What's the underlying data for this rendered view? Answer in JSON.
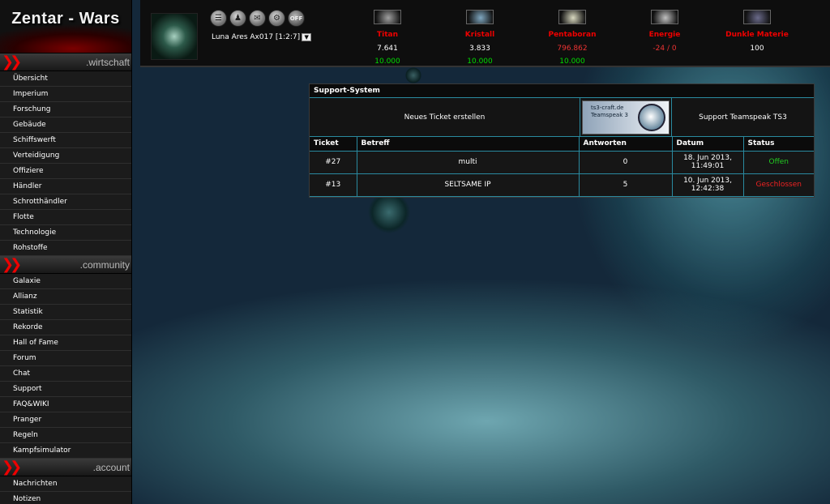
{
  "sidebar": {
    "logo": "Zentar - Wars",
    "sections": [
      {
        "title": ".wirtschaft",
        "items": [
          "Übersicht",
          "Imperium",
          "Forschung",
          "Gebäude",
          "Schiffswerft",
          "Verteidigung",
          "Offiziere",
          "Händler",
          "Schrotthändler",
          "Flotte",
          "Technologie",
          "Rohstoffe"
        ]
      },
      {
        "title": ".community",
        "items": [
          "Galaxie",
          "Allianz",
          "Statistik",
          "Rekorde",
          "Hall of Fame",
          "Forum",
          "Chat",
          "Support",
          "FAQ&WIKI",
          "Pranger",
          "Regeln",
          "Kampfsimulator"
        ]
      },
      {
        "title": ".account",
        "items": [
          "Nachrichten",
          "Notizen"
        ]
      }
    ]
  },
  "topbar": {
    "planet": "Luna Ares Ax017 [1:2:7]",
    "icons": [
      "notes-icon",
      "buddy-icon",
      "mail-icon",
      "settings-icon"
    ],
    "off_label": "OFF",
    "resources": [
      {
        "name": "Titan",
        "amount": "7.641",
        "cap": "10.000",
        "img_color": "#a0a0a0",
        "amount_red": false
      },
      {
        "name": "Kristall",
        "amount": "3.833",
        "cap": "10.000",
        "img_color": "#7fa7c0",
        "amount_red": false
      },
      {
        "name": "Pentaboran",
        "amount": "796.862",
        "cap": "10.000",
        "img_color": "#d9d9c0",
        "amount_red": true
      },
      {
        "name": "Energie",
        "amount": "-24 / 0",
        "cap": "",
        "img_color": "#c0c0c0",
        "amount_red": true
      },
      {
        "name": "Dunkle Materie",
        "amount": "100",
        "cap": "",
        "img_color": "#6a6a8a",
        "amount_red": false
      }
    ]
  },
  "support": {
    "title": "Support-System",
    "new_ticket": "Neues Ticket erstellen",
    "banner_line1": "ts3-craft.de",
    "banner_line2": "Teamspeak 3",
    "ts_link": "Support Teamspeak TS3",
    "columns": [
      "Ticket",
      "Betreff",
      "Antworten",
      "Datum",
      "Status"
    ],
    "rows": [
      {
        "ticket": "#27",
        "subject": "multi",
        "answers": "0",
        "date1": "18. Jun 2013,",
        "date2": "11:49:01",
        "status": "Offen",
        "state": "open"
      },
      {
        "ticket": "#13",
        "subject": "SELTSAME IP",
        "answers": "5",
        "date1": "10. Jun 2013,",
        "date2": "12:42:38",
        "status": "Geschlossen",
        "state": "closed"
      }
    ]
  },
  "colors": {
    "accent_red": "#e00000",
    "capacity_green": "#00dd00",
    "table_border": "#2a8aa0"
  }
}
